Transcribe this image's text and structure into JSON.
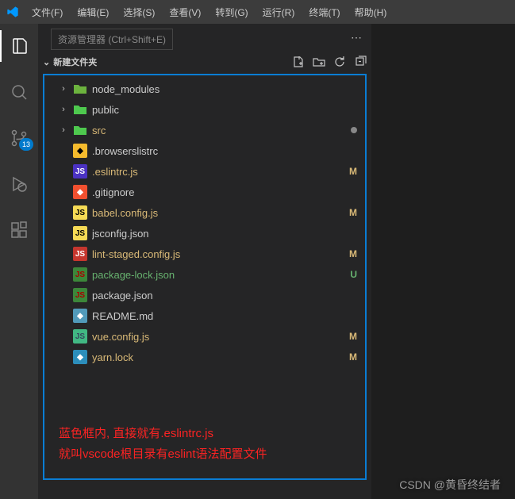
{
  "menu": {
    "items": [
      "文件(F)",
      "编辑(E)",
      "选择(S)",
      "查看(V)",
      "转到(G)",
      "运行(R)",
      "终端(T)",
      "帮助(H)"
    ]
  },
  "activitybar": {
    "scm_badge": "13"
  },
  "sidebar": {
    "tooltip": "资源管理器 (Ctrl+Shift+E)",
    "section_title": "新建文件夹"
  },
  "tree": [
    {
      "name": "node_modules",
      "kind": "folder",
      "icon_bg": "#6cb33e",
      "icon_fg": "#262",
      "chevron": "right",
      "color": "#cccccc",
      "status": ""
    },
    {
      "name": "public",
      "kind": "folder",
      "icon_bg": "#4ec94e",
      "icon_fg": "#fff",
      "chevron": "right",
      "color": "#cccccc",
      "status": ""
    },
    {
      "name": "src",
      "kind": "folder",
      "icon_bg": "#4ec94e",
      "icon_fg": "#fff",
      "chevron": "right",
      "color": "#d9b977",
      "status": "dot",
      "status_color": "#888"
    },
    {
      "name": ".browserslistrc",
      "kind": "file",
      "icon_bg": "#f5bb2d",
      "icon_fg": "#000",
      "chevron": "none",
      "color": "#cccccc",
      "status": ""
    },
    {
      "name": ".eslintrc.js",
      "kind": "file",
      "icon_bg": "#4b32c3",
      "icon_fg": "#fff",
      "chevron": "none",
      "color": "#d9b977",
      "status": "M",
      "status_color": "#d9b977"
    },
    {
      "name": ".gitignore",
      "kind": "file",
      "icon_bg": "#f1502f",
      "icon_fg": "#fff",
      "chevron": "none",
      "color": "#cccccc",
      "status": ""
    },
    {
      "name": "babel.config.js",
      "kind": "file",
      "icon_bg": "#f5da55",
      "icon_fg": "#000",
      "chevron": "none",
      "color": "#d9b977",
      "status": "M",
      "status_color": "#d9b977"
    },
    {
      "name": "jsconfig.json",
      "kind": "file",
      "icon_bg": "#f5da55",
      "icon_fg": "#000",
      "chevron": "none",
      "color": "#cccccc",
      "status": ""
    },
    {
      "name": "lint-staged.config.js",
      "kind": "file",
      "icon_bg": "#c6362e",
      "icon_fg": "#fff",
      "chevron": "none",
      "color": "#d9b977",
      "status": "M",
      "status_color": "#d9b977"
    },
    {
      "name": "package-lock.json",
      "kind": "file",
      "icon_bg": "#3c873a",
      "icon_fg": "#a00",
      "chevron": "none",
      "color": "#67b26f",
      "status": "U",
      "status_color": "#67b26f"
    },
    {
      "name": "package.json",
      "kind": "file",
      "icon_bg": "#3c873a",
      "icon_fg": "#a00",
      "chevron": "none",
      "color": "#cccccc",
      "status": ""
    },
    {
      "name": "README.md",
      "kind": "file",
      "icon_bg": "#519aba",
      "icon_fg": "#fff",
      "chevron": "none",
      "color": "#cccccc",
      "status": ""
    },
    {
      "name": "vue.config.js",
      "kind": "file",
      "icon_bg": "#41b883",
      "icon_fg": "#35495e",
      "chevron": "none",
      "color": "#d9b977",
      "status": "M",
      "status_color": "#d9b977"
    },
    {
      "name": "yarn.lock",
      "kind": "file",
      "icon_bg": "#2c8ebb",
      "icon_fg": "#fff",
      "chevron": "none",
      "color": "#d9b977",
      "status": "M",
      "status_color": "#d9b977"
    }
  ],
  "annotation": {
    "line1": "蓝色框内, 直接就有.eslintrc.js",
    "line2": "就叫vscode根目录有eslint语法配置文件"
  },
  "watermark": "CSDN @黄昏终结者"
}
